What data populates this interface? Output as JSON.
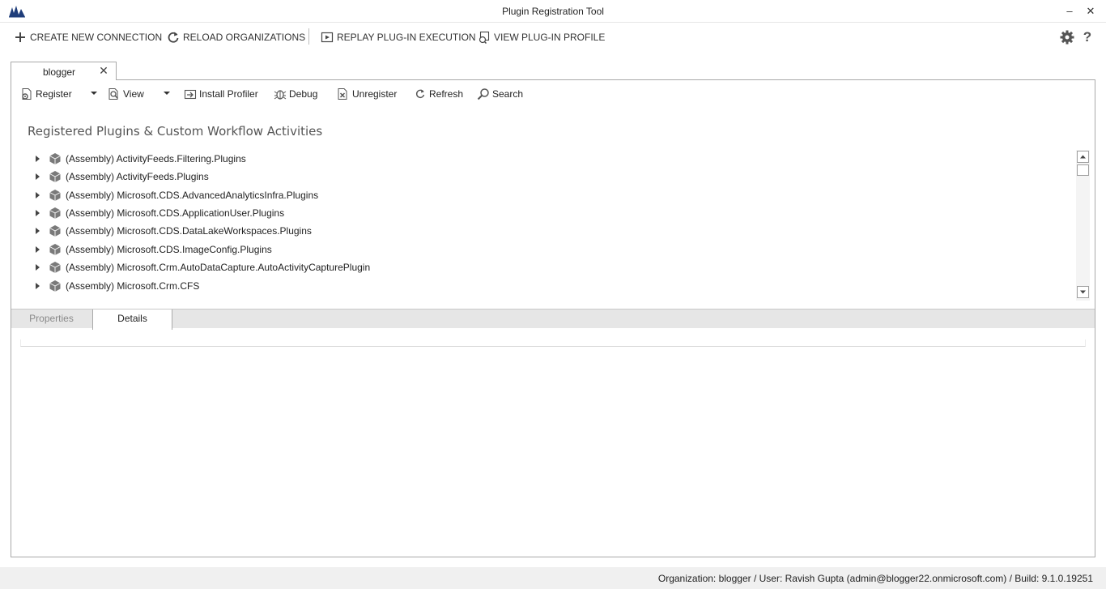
{
  "window": {
    "title": "Plugin Registration Tool",
    "minimize_glyph": "–",
    "close_glyph": "✕"
  },
  "main_toolbar": {
    "create_connection": "CREATE NEW CONNECTION",
    "reload_organizations": "RELOAD ORGANIZATIONS",
    "replay_execution": "REPLAY PLUG-IN EXECUTION",
    "view_profile": "VIEW PLUG-IN PROFILE"
  },
  "connection_tab": {
    "label": "blogger",
    "close_glyph": "✕"
  },
  "inner_toolbar": {
    "register": "Register",
    "view": "View",
    "install_profiler": "Install Profiler",
    "debug": "Debug",
    "unregister": "Unregister",
    "refresh": "Refresh",
    "search": "Search"
  },
  "section_heading": "Registered Plugins & Custom Workflow Activities",
  "tree": {
    "items": [
      "(Assembly) ActivityFeeds.Filtering.Plugins",
      "(Assembly) ActivityFeeds.Plugins",
      "(Assembly) Microsoft.CDS.AdvancedAnalyticsInfra.Plugins",
      "(Assembly) Microsoft.CDS.ApplicationUser.Plugins",
      "(Assembly) Microsoft.CDS.DataLakeWorkspaces.Plugins",
      "(Assembly) Microsoft.CDS.ImageConfig.Plugins",
      "(Assembly) Microsoft.Crm.AutoDataCapture.AutoActivityCapturePlugin",
      "(Assembly) Microsoft.Crm.CFS"
    ]
  },
  "bottom_tabs": {
    "properties": "Properties",
    "details": "Details"
  },
  "status": "Organization: blogger / User: Ravish Gupta (admin@blogger22.onmicrosoft.com) / Build: 9.1.0.19251",
  "colors": {
    "logo_blue": "#1f3d7a",
    "icon_gray": "#6b6b6b",
    "status_bg": "#f0f0f0"
  }
}
